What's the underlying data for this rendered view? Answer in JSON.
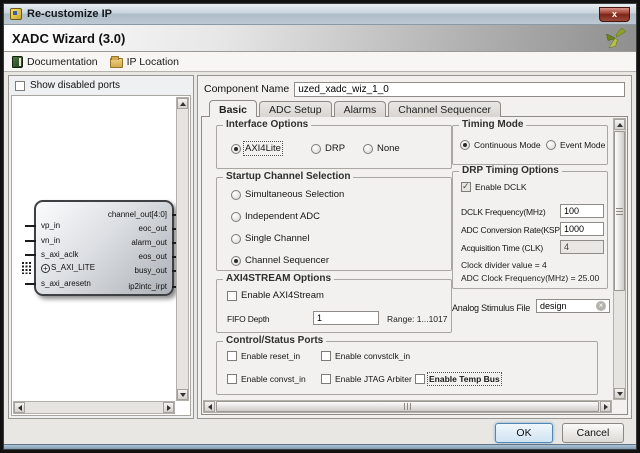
{
  "window": {
    "title": "Re-customize IP",
    "close_glyph": "x"
  },
  "header": {
    "title": "XADC Wizard (3.0)"
  },
  "toolbar": {
    "documentation": "Documentation",
    "ip_location": "IP Location"
  },
  "left_panel": {
    "show_disabled_ports": "Show disabled ports",
    "block": {
      "left_ports": [
        "vp_in",
        "vn_in",
        "s_axi_aclk",
        "S_AXI_LITE",
        "s_axi_aresetn"
      ],
      "right_ports": [
        "channel_out[4:0]",
        "eoc_out",
        "alarm_out",
        "eos_out",
        "busy_out",
        "ip2intc_irpt"
      ],
      "plus_glyph": "+"
    }
  },
  "component": {
    "label": "Component Name",
    "value": "uzed_xadc_wiz_1_0"
  },
  "tabs": [
    {
      "label": "Basic",
      "active": true
    },
    {
      "label": "ADC Setup",
      "active": false
    },
    {
      "label": "Alarms",
      "active": false
    },
    {
      "label": "Channel Sequencer",
      "active": false
    }
  ],
  "interface_options": {
    "title": "Interface Options",
    "options": [
      {
        "label": "AXI4Lite",
        "selected": true
      },
      {
        "label": "DRP",
        "selected": false
      },
      {
        "label": "None",
        "selected": false
      }
    ]
  },
  "startup_channel_selection": {
    "title": "Startup Channel Selection",
    "options": [
      {
        "label": "Simultaneous Selection",
        "selected": false
      },
      {
        "label": "Independent ADC",
        "selected": false
      },
      {
        "label": "Single Channel",
        "selected": false
      },
      {
        "label": "Channel Sequencer",
        "selected": true
      }
    ]
  },
  "axi4stream_options": {
    "title": "AXI4STREAM Options",
    "enable_label": "Enable AXI4Stream",
    "enable_checked": false,
    "fifo_depth_label": "FIFO Depth",
    "fifo_depth_value": "1",
    "range_text": "Range: 1...1017"
  },
  "control_status_ports": {
    "title": "Control/Status Ports",
    "items": [
      {
        "label": "Enable reset_in",
        "checked": false
      },
      {
        "label": "Enable convstclk_in",
        "checked": false
      },
      {
        "label": "Enable convst_in",
        "checked": false
      },
      {
        "label": "Enable JTAG Arbiter",
        "checked": false
      },
      {
        "label": "Enable Temp Bus",
        "checked": false
      }
    ]
  },
  "timing_mode": {
    "title": "Timing Mode",
    "options": [
      {
        "label": "Continuous Mode",
        "selected": true
      },
      {
        "label": "Event Mode",
        "selected": false
      }
    ]
  },
  "drp_timing_options": {
    "title": "DRP Timing Options",
    "enable_dclk_label": "Enable DCLK",
    "enable_dclk_checked": true,
    "dclk_frequency_label": "DCLK Frequency(MHz)",
    "dclk_frequency_value": "100",
    "adc_conversion_rate_label": "ADC Conversion Rate(KSPS)",
    "adc_conversion_rate_value": "1000",
    "acquisition_time_label": "Acquisition Time (CLK)",
    "acquisition_time_value": "4",
    "clock_divider_text": "Clock divider value = 4",
    "adc_clock_text": "ADC Clock Frequency(MHz) = 25.00"
  },
  "analog_stimulus": {
    "label": "Analog Stimulus File",
    "value": "design",
    "clear_glyph": "×"
  },
  "footer": {
    "ok": "OK",
    "cancel": "Cancel"
  },
  "colors": {
    "close_button_red": "#7c2417",
    "ok_focus_blue": "#4f86b2",
    "titlebar_steel": "#aebcc7",
    "block_gradient_dark": "#adb2b8"
  }
}
